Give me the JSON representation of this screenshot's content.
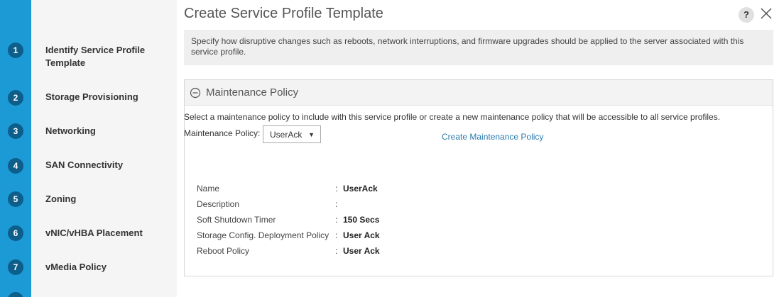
{
  "wizard": {
    "steps": [
      {
        "number": "1",
        "label": "Identify Service Profile Template"
      },
      {
        "number": "2",
        "label": "Storage Provisioning"
      },
      {
        "number": "3",
        "label": "Networking"
      },
      {
        "number": "4",
        "label": "SAN Connectivity"
      },
      {
        "number": "5",
        "label": "Zoning"
      },
      {
        "number": "6",
        "label": "vNIC/vHBA Placement"
      },
      {
        "number": "7",
        "label": "vMedia Policy"
      }
    ]
  },
  "header": {
    "title": "Create Service Profile Template",
    "help_label": "?",
    "help_icon": "question-icon",
    "close_icon": "close-icon"
  },
  "info": {
    "text": "Specify how disruptive changes such as reboots, network interruptions, and firmware upgrades should be applied to the server associated with this service profile."
  },
  "panel": {
    "title": "Maintenance Policy",
    "collapse_icon": "minus-circle-icon",
    "intro": "Select a maintenance policy to include with this service profile or create a new maintenance policy that will be accessible to all service profiles.",
    "policy_label": "Maintenance Policy:",
    "selected_policy": "UserAck",
    "create_link": "Create Maintenance Policy",
    "properties": [
      {
        "name": "Name",
        "value": "UserAck"
      },
      {
        "name": "Description",
        "value": ""
      },
      {
        "name": "Soft Shutdown Timer",
        "value": "150 Secs"
      },
      {
        "name": "Storage Config. Deployment Policy",
        "value": "User Ack"
      },
      {
        "name": "Reboot Policy",
        "value": "User Ack"
      }
    ]
  },
  "colors": {
    "rail": "#1b9ad6",
    "step_badge": "#0d5e8a",
    "link": "#2a7aae"
  }
}
